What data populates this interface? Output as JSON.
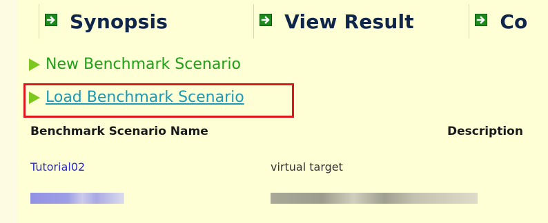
{
  "tabs": [
    {
      "label": "Synopsis",
      "icon": "arrow-right-icon"
    },
    {
      "label": "View Result",
      "icon": "arrow-right-icon"
    },
    {
      "label": "Co",
      "icon": "arrow-right-icon"
    }
  ],
  "links": {
    "new_scenario": "New Benchmark Scenario",
    "load_scenario": "Load Benchmark Scenario"
  },
  "table": {
    "headers": {
      "name": "Benchmark Scenario Name",
      "description": "Description"
    },
    "rows": [
      {
        "name": "Tutorial02",
        "description": "virtual target"
      }
    ]
  },
  "colors": {
    "background": "#ffffd6",
    "tab_arrow": "#1e8a1e",
    "link_new": "#1ea018",
    "link_load": "#1a9ab8",
    "highlight": "#e0141c",
    "row_link": "#2a2ad0"
  }
}
